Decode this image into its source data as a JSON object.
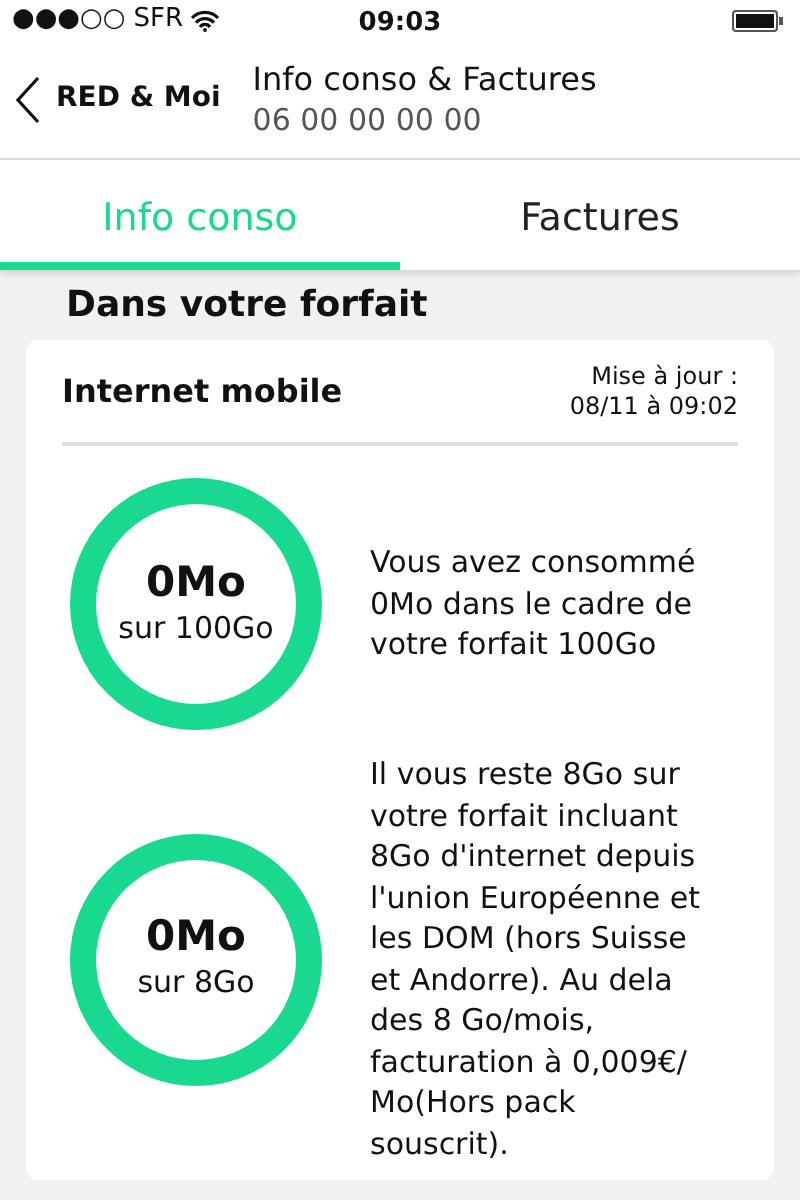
{
  "status_bar": {
    "signal": "●●●○○",
    "carrier": "SFR",
    "time": "09:03"
  },
  "nav": {
    "back_label": "RED & Moi",
    "title": "Info conso & Factures",
    "subtitle": "06 00 00 00 00"
  },
  "tabs": [
    {
      "label": "Info conso",
      "selected": true
    },
    {
      "label": "Factures",
      "selected": false
    }
  ],
  "section_title": "Dans votre forfait",
  "card": {
    "title": "Internet mobile",
    "update_label": "Mise à jour :",
    "update_time": "08/11 à 09:02",
    "items": [
      {
        "amount": "0Mo",
        "total": "sur 100Go",
        "text": "Vous avez consommé 0Mo dans le cadre de votre forfait 100Go"
      },
      {
        "amount": "0Mo",
        "total": "sur 8Go",
        "text": "Il vous reste 8Go sur votre forfait incluant 8Go d'internet depuis l'union Européenne et les DOM (hors Suisse et Andorre). Au dela des 8 Go/mois, facturation à 0,009€/ Mo(Hors pack souscrit)."
      }
    ]
  }
}
